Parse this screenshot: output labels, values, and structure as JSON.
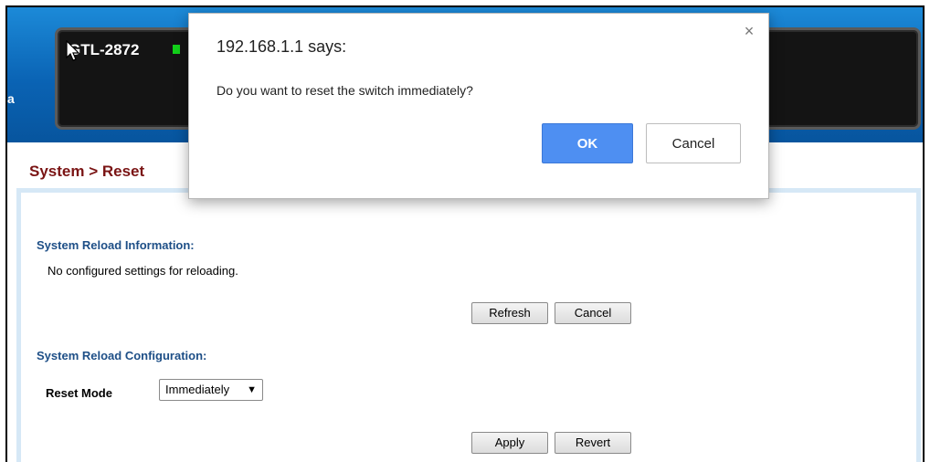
{
  "header": {
    "edge_text": "a",
    "device_model": "GTL-2872",
    "status_led_color": "#12d11a"
  },
  "breadcrumb": "System > Reset",
  "reload_info": {
    "title": "System Reload Information:",
    "message": "No configured settings for reloading.",
    "refresh_label": "Refresh",
    "cancel_label": "Cancel"
  },
  "reload_config": {
    "title": "System Reload Configuration:",
    "reset_mode_label": "Reset Mode",
    "reset_mode_value": "Immediately",
    "apply_label": "Apply",
    "revert_label": "Revert"
  },
  "dialog": {
    "title": "192.168.1.1 says:",
    "message": "Do you want to reset the switch immediately?",
    "ok_label": "OK",
    "cancel_label": "Cancel",
    "close_glyph": "×"
  },
  "icons": {
    "cursor": "mouse-cursor-icon",
    "close": "close-icon",
    "dropdown": "chevron-down-icon"
  },
  "colors": {
    "header_blue": "#0a63b4",
    "breadcrumb": "#7a1414",
    "section_title": "#1e4f87",
    "ok_button": "#4e8ff2"
  }
}
